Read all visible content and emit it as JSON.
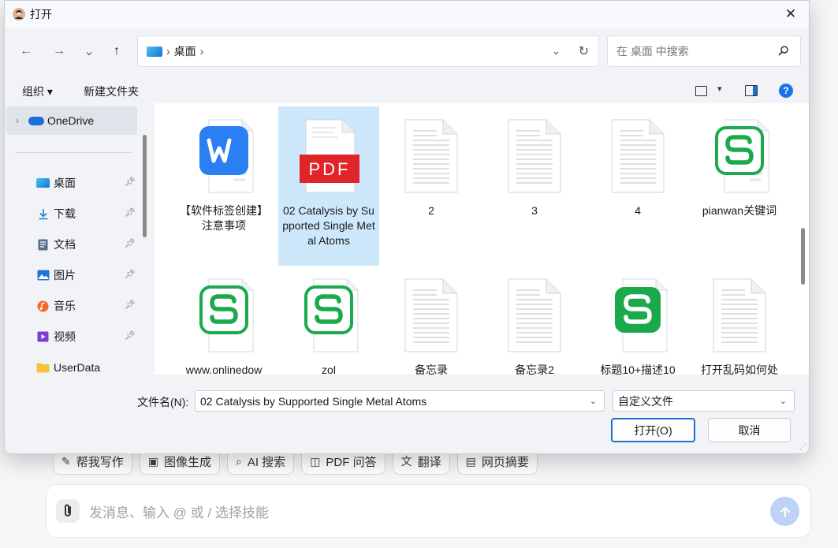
{
  "dialog": {
    "title": "打开",
    "close_glyph": "✕"
  },
  "navbar": {
    "back": "←",
    "forward": "→",
    "recent": "⌄",
    "up": "↑",
    "breadcrumb_sep": "›",
    "breadcrumb": "桌面",
    "address_dropdown": "⌄",
    "refresh": "↻",
    "search_placeholder": "在 桌面 中搜索"
  },
  "commandbar": {
    "organize": "组织 ▾",
    "new_folder": "新建文件夹",
    "view_dropdown": "▾",
    "help": "?"
  },
  "sidebar": {
    "onedrive": "OneDrive",
    "items": [
      {
        "label": "桌面",
        "icon": "desktop-icon"
      },
      {
        "label": "下载",
        "icon": "download-icon"
      },
      {
        "label": "文档",
        "icon": "documents-icon"
      },
      {
        "label": "图片",
        "icon": "pictures-icon"
      },
      {
        "label": "音乐",
        "icon": "music-icon"
      },
      {
        "label": "视频",
        "icon": "videos-icon"
      },
      {
        "label": "UserData",
        "icon": "folder-icon"
      }
    ]
  },
  "files": [
    {
      "name": "【软件标签创建】注意事项",
      "type": "wps-writer"
    },
    {
      "name": "02 Catalysis by Supported Single Metal Atoms",
      "type": "pdf",
      "selected": true
    },
    {
      "name": "2",
      "type": "text"
    },
    {
      "name": "3",
      "type": "text"
    },
    {
      "name": "4",
      "type": "text"
    },
    {
      "name": "pianwan关键词",
      "type": "wps-sheet"
    },
    {
      "name": "www.onlinedow",
      "type": "wps-sheet"
    },
    {
      "name": "zol",
      "type": "wps-sheet"
    },
    {
      "name": "备忘录",
      "type": "text"
    },
    {
      "name": "备忘录2",
      "type": "text"
    },
    {
      "name": "标题10+描述10",
      "type": "wps-sheet-solid"
    },
    {
      "name": "打开乱码如何处",
      "type": "text"
    }
  ],
  "bottom": {
    "filename_label": "文件名(N):",
    "filename_value": "02 Catalysis by Supported Single Metal Atoms",
    "filetype_value": "自定义文件",
    "open_button": "打开(O)",
    "cancel_button": "取消"
  },
  "background_app": {
    "tools": [
      {
        "label": "帮我写作",
        "glyph": "✎"
      },
      {
        "label": "图像生成",
        "glyph": "▣"
      },
      {
        "label": "AI 搜索",
        "glyph": "⌕"
      },
      {
        "label": "PDF 问答",
        "glyph": "◫"
      },
      {
        "label": "翻译",
        "glyph": "文"
      },
      {
        "label": "网页摘要",
        "glyph": "▤"
      }
    ],
    "input_placeholder": "发消息、输入 @ 或 / 选择技能"
  },
  "colors": {
    "accent": "#1a6fd0",
    "selection": "#cde8fb",
    "pdf_red": "#e0242a",
    "wps_blue": "#2a7ff3",
    "wps_green": "#1aaa4b"
  }
}
